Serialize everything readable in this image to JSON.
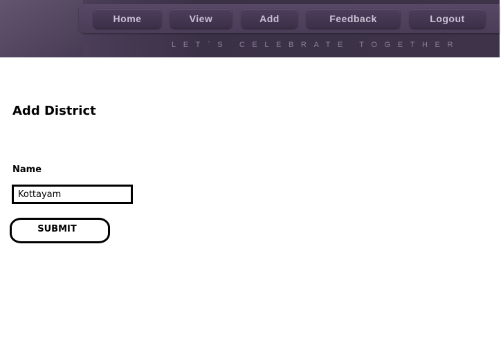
{
  "header": {
    "nav": {
      "home": "Home",
      "view": "View",
      "add": "Add",
      "feedback": "Feedback",
      "logout": "Logout"
    },
    "tagline": "LET`S CELEBRATE TOGETHER"
  },
  "main": {
    "title": "Add District",
    "form": {
      "name_label": "Name",
      "name_value": "Kottayam",
      "submit_label": "SUBMIT"
    }
  }
}
